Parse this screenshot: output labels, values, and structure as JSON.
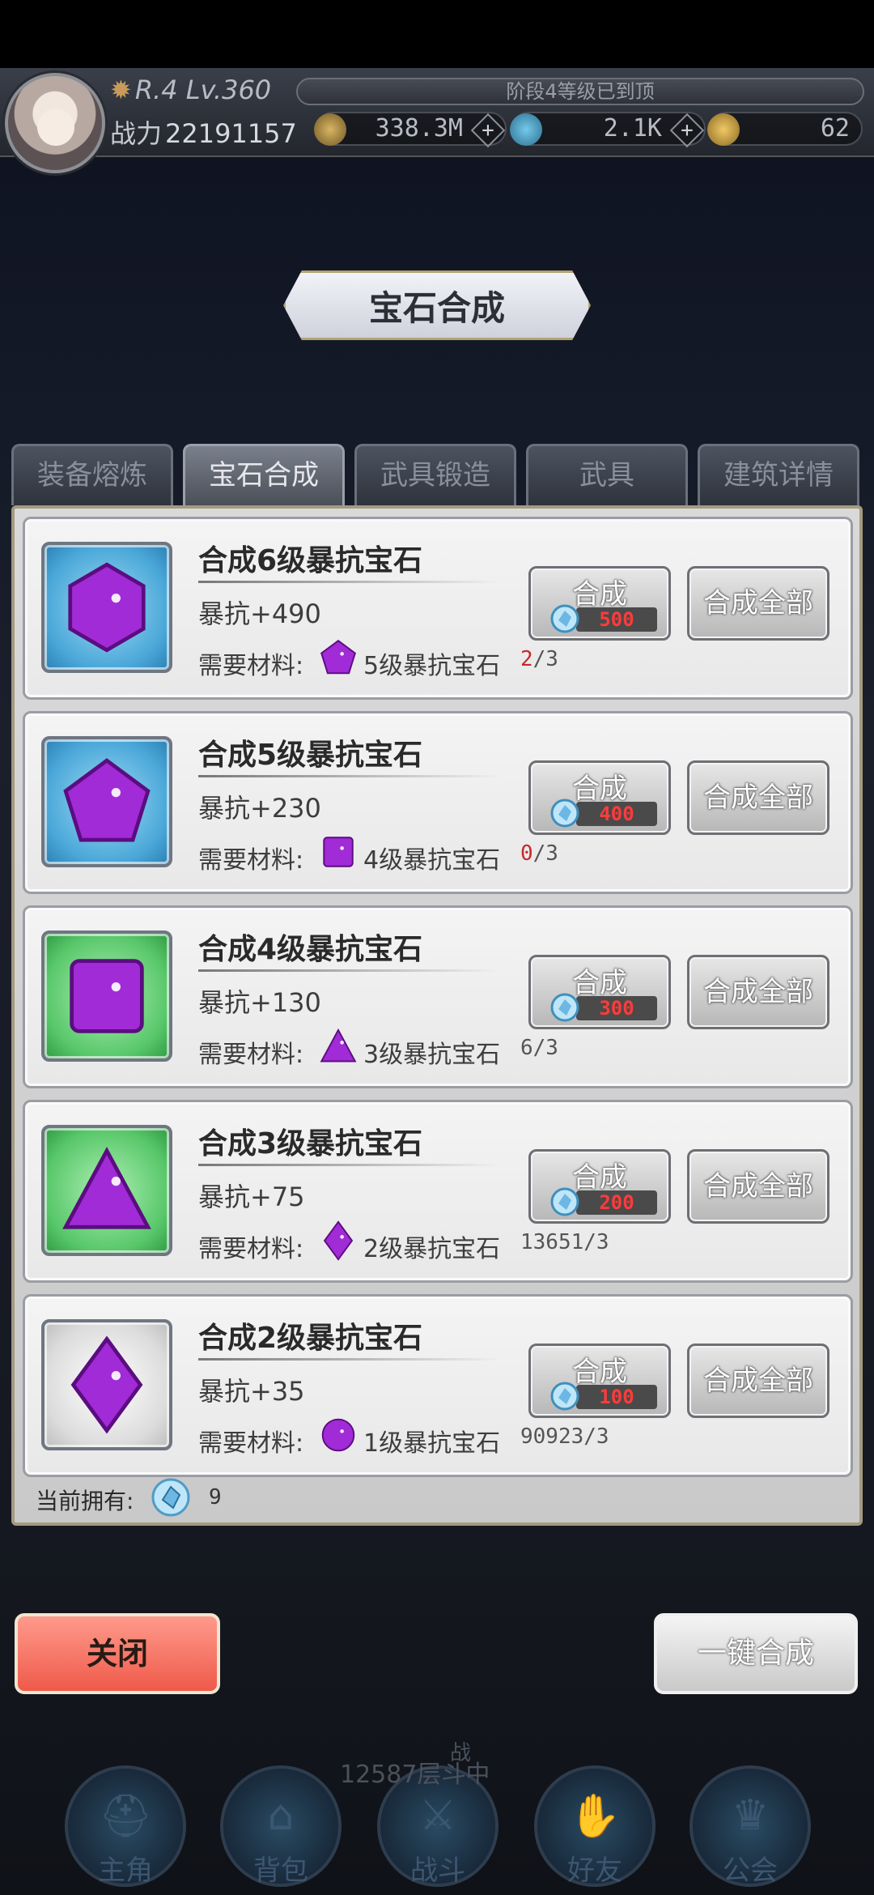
{
  "header": {
    "rank": "R.4 Lv.360",
    "power_label": "战力",
    "power_value": "22191157",
    "stage_text": "阶段4等级已到顶",
    "resources": [
      {
        "icon": "gold-coin-icon",
        "value": "338.3M"
      },
      {
        "icon": "crystal-icon",
        "value": "2.1K"
      },
      {
        "icon": "gold-gem-icon",
        "value": "62"
      }
    ]
  },
  "title": "宝石合成",
  "tabs": [
    {
      "label": "装备熔炼",
      "active": false
    },
    {
      "label": "宝石合成",
      "active": true
    },
    {
      "label": "武具锻造",
      "active": false
    },
    {
      "label": "武具",
      "active": false
    },
    {
      "label": "建筑详情",
      "active": false
    }
  ],
  "rows": [
    {
      "title": "合成6级暴抗宝石",
      "stat": "暴抗+490",
      "req_label": "需要材料:",
      "req_name": "5级暴抗宝石",
      "have": "2",
      "need": "/3",
      "low": true,
      "btn": "合成",
      "cost": "500",
      "btn_all": "合成全部",
      "gem": "hexagon",
      "bg": "blue",
      "req_gem": "pentagon"
    },
    {
      "title": "合成5级暴抗宝石",
      "stat": "暴抗+230",
      "req_label": "需要材料:",
      "req_name": "4级暴抗宝石",
      "have": "0",
      "need": "/3",
      "low": true,
      "btn": "合成",
      "cost": "400",
      "btn_all": "合成全部",
      "gem": "pentagon",
      "bg": "blue",
      "req_gem": "square"
    },
    {
      "title": "合成4级暴抗宝石",
      "stat": "暴抗+130",
      "req_label": "需要材料:",
      "req_name": "3级暴抗宝石",
      "have": "6",
      "need": "/3",
      "low": false,
      "btn": "合成",
      "cost": "300",
      "btn_all": "合成全部",
      "gem": "square",
      "bg": "green",
      "req_gem": "triangle"
    },
    {
      "title": "合成3级暴抗宝石",
      "stat": "暴抗+75",
      "req_label": "需要材料:",
      "req_name": "2级暴抗宝石",
      "have": "13651",
      "need": "/3",
      "low": false,
      "btn": "合成",
      "cost": "200",
      "btn_all": "合成全部",
      "gem": "triangle",
      "bg": "green",
      "req_gem": "diamond"
    },
    {
      "title": "合成2级暴抗宝石",
      "stat": "暴抗+35",
      "req_label": "需要材料:",
      "req_name": "1级暴抗宝石",
      "have": "90923",
      "need": "/3",
      "low": false,
      "btn": "合成",
      "cost": "100",
      "btn_all": "合成全部",
      "gem": "diamond",
      "bg": "gray",
      "req_gem": "circle"
    }
  ],
  "owned": {
    "label": "当前拥有:",
    "value": "9"
  },
  "buttons": {
    "close": "关闭",
    "one_click": "一键合成"
  },
  "battle": {
    "floor": "12587层",
    "status_top": "战",
    "status_rest": "斗中"
  },
  "nav": [
    {
      "label": "主角",
      "icon": "hero-icon"
    },
    {
      "label": "背包",
      "icon": "backpack-icon"
    },
    {
      "label": "战斗",
      "icon": "swords-icon"
    },
    {
      "label": "好友",
      "icon": "handshake-icon"
    },
    {
      "label": "公会",
      "icon": "guild-crest-icon"
    }
  ],
  "colors": {
    "gem_purple": "#a12bd6",
    "accent_red": "#ef5a4a",
    "cost_red": "#ff3b3b"
  }
}
